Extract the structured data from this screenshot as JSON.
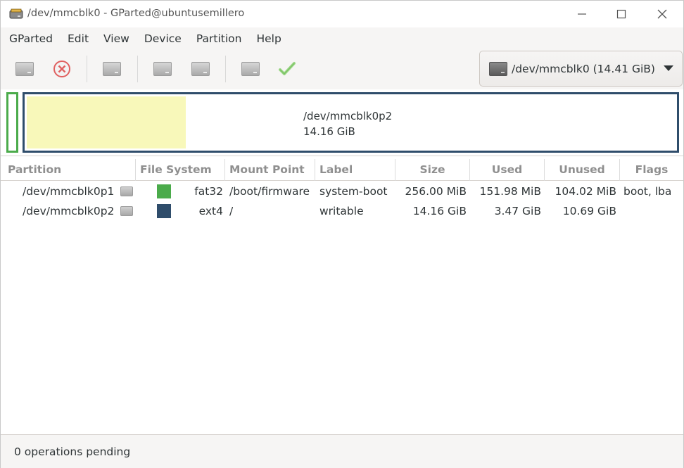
{
  "window": {
    "title": "/dev/mmcblk0 - GParted@ubuntusemillero"
  },
  "menubar": {
    "items": [
      "GParted",
      "Edit",
      "View",
      "Device",
      "Partition",
      "Help"
    ]
  },
  "toolbar": {
    "buttons": [
      {
        "icon": "new-partition-icon",
        "enabled": false
      },
      {
        "icon": "delete-icon",
        "enabled": true
      },
      {
        "icon": "resize-move-icon",
        "enabled": false
      },
      {
        "icon": "copy-icon",
        "enabled": false
      },
      {
        "icon": "paste-icon",
        "enabled": false
      },
      {
        "icon": "undo-icon",
        "enabled": false
      },
      {
        "icon": "apply-checkmark-icon",
        "enabled": true
      }
    ],
    "device_selector": "/dev/mmcblk0 (14.41 GiB)"
  },
  "map": {
    "selected_name": "/dev/mmcblk0p2",
    "selected_size": "14.16 GiB",
    "p2_used_fraction": 0.245,
    "colors": {
      "fat32": "#4bab4b",
      "ext4": "#2f4d6b",
      "used": "#f8f8ba"
    }
  },
  "table": {
    "headers": [
      "Partition",
      "File System",
      "Mount Point",
      "Label",
      "Size",
      "Used",
      "Unused",
      "Flags"
    ],
    "rows": [
      {
        "partition": "/dev/mmcblk0p1",
        "fs": "fat32",
        "fs_color": "#4bab4b",
        "mount": "/boot/firmware",
        "label": "system-boot",
        "size": "256.00 MiB",
        "used": "151.98 MiB",
        "unused": "104.02 MiB",
        "flags": "boot, lba"
      },
      {
        "partition": "/dev/mmcblk0p2",
        "fs": "ext4",
        "fs_color": "#2f4d6b",
        "mount": "/",
        "label": "writable",
        "size": "14.16 GiB",
        "used": "3.47 GiB",
        "unused": "10.69 GiB",
        "flags": ""
      }
    ]
  },
  "status": {
    "text": "0 operations pending"
  }
}
